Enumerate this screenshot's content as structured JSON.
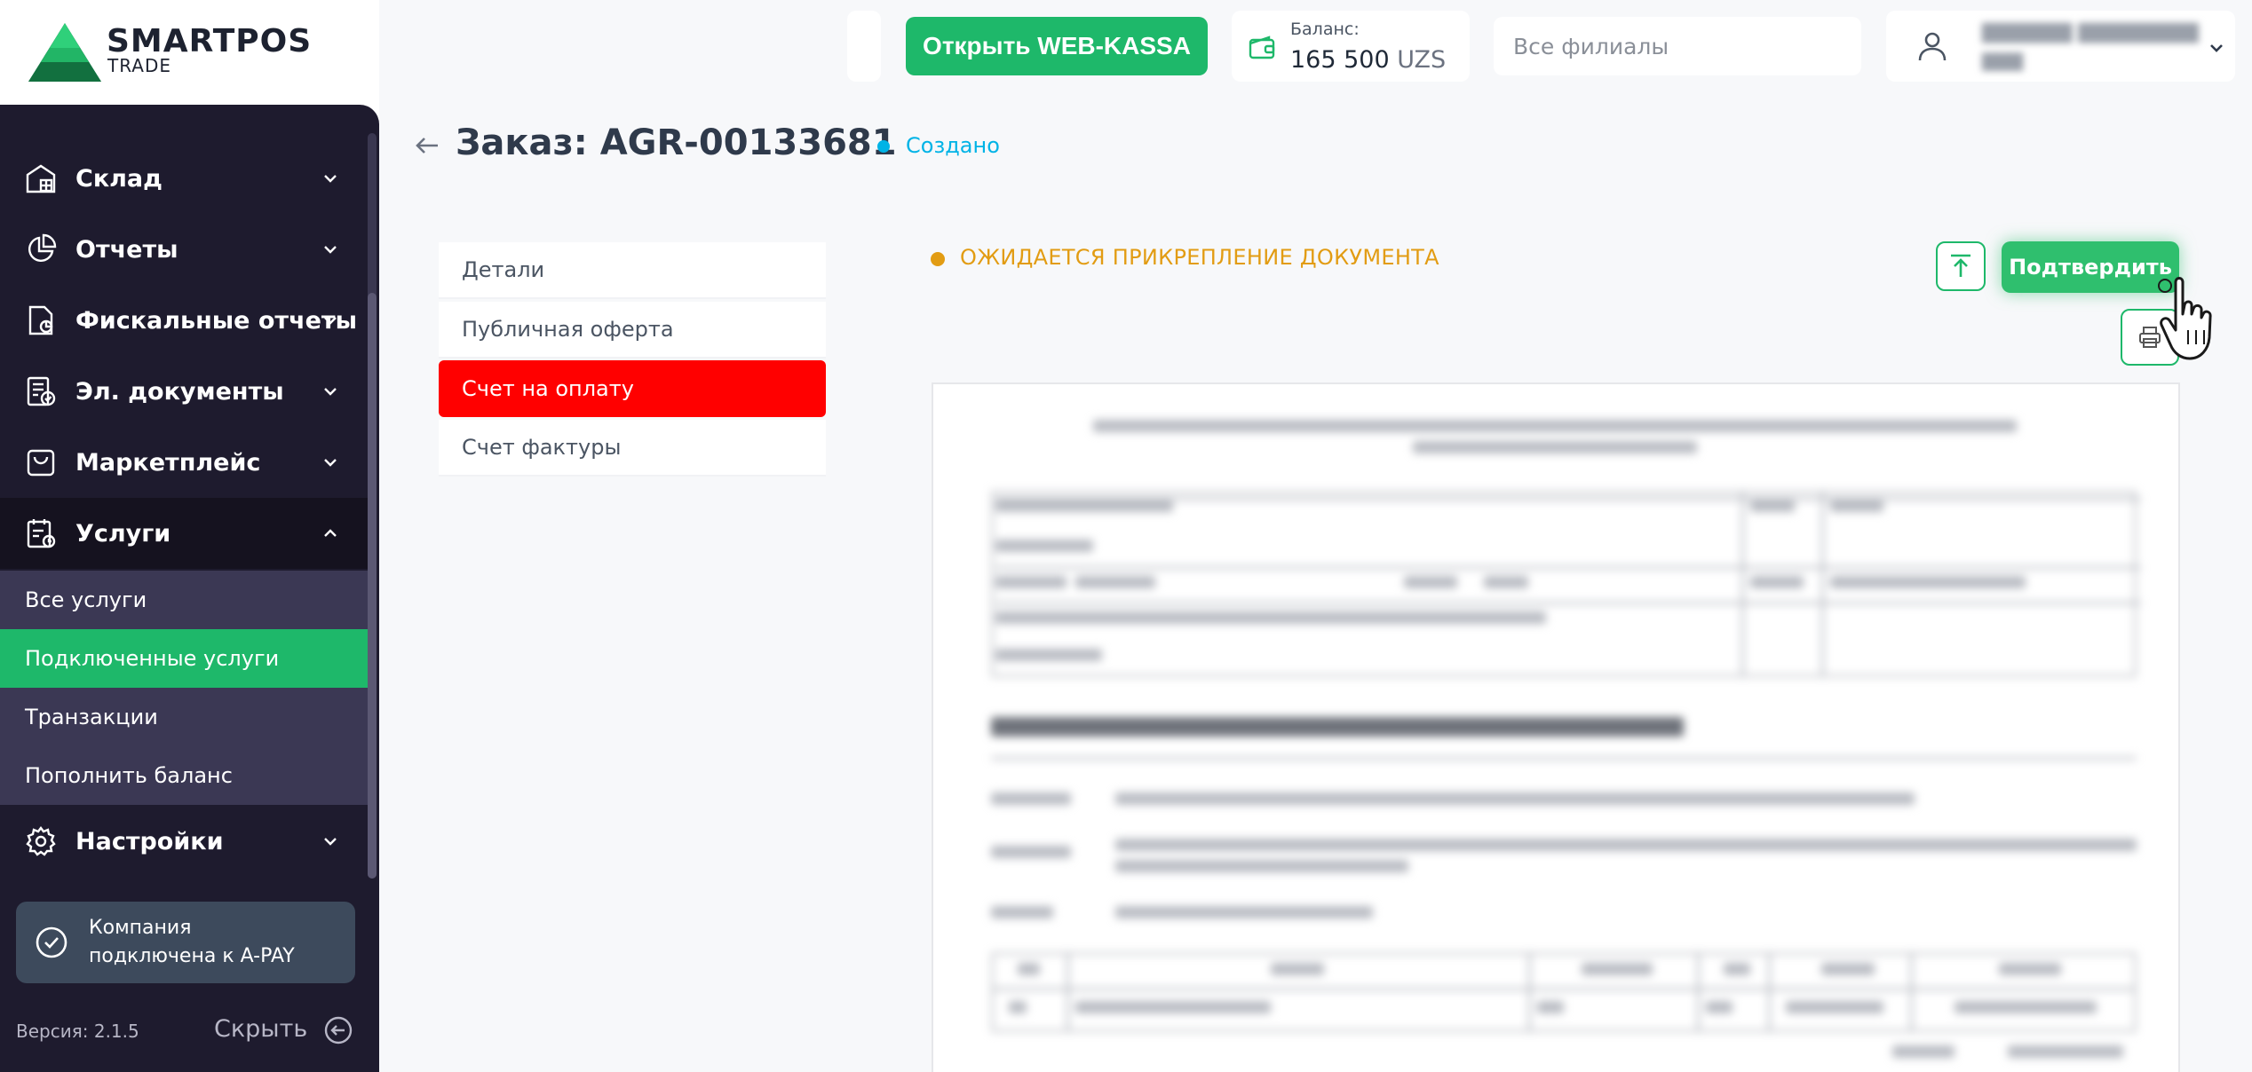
{
  "app": {
    "logo_title": "SMARTPOS",
    "logo_sub": "TRADE",
    "brand_color": "#1eb86a"
  },
  "sidebar": {
    "items": [
      {
        "label": "Склад",
        "icon": "warehouse-icon"
      },
      {
        "label": "Отчеты",
        "icon": "pie-chart-icon"
      },
      {
        "label": "Фискальные отчеты",
        "icon": "fiscal-report-icon"
      },
      {
        "label": "Эл. документы",
        "icon": "e-documents-icon"
      },
      {
        "label": "Маркетплейс",
        "icon": "shopping-bag-icon"
      },
      {
        "label": "Услуги",
        "icon": "services-icon",
        "expanded": true
      },
      {
        "label": "Настройки",
        "icon": "gear-icon"
      }
    ],
    "services_sub": [
      {
        "label": "Все услуги"
      },
      {
        "label": "Подключенные услуги",
        "active": true
      },
      {
        "label": "Транзакции"
      },
      {
        "label": "Пополнить баланс"
      }
    ],
    "apay_line1": "Компания",
    "apay_line2": "подключена к A-PAY",
    "version": "Версия: 2.1.5",
    "hide_label": "Скрыть"
  },
  "header": {
    "webkassa_label": "Открыть WEB-KASSA",
    "balance_label": "Баланс:",
    "balance_amount": "165 500",
    "balance_currency": "UZS",
    "branch_placeholder": "Все филиалы"
  },
  "page": {
    "title": "Заказ: AGR-00133681",
    "status": "Создано",
    "status_color": "#00b3e6",
    "tabs": [
      {
        "label": "Детали"
      },
      {
        "label": "Публичная оферта"
      },
      {
        "label": "Счет на оплату",
        "active": true
      },
      {
        "label": "Счет фактуры"
      }
    ],
    "pending_notice": "ОЖИДАЕТСЯ ПРИКРЕПЛЕНИЕ ДОКУМЕНТА",
    "pending_color": "#e29c13",
    "confirm_label": "Подтвердить"
  }
}
